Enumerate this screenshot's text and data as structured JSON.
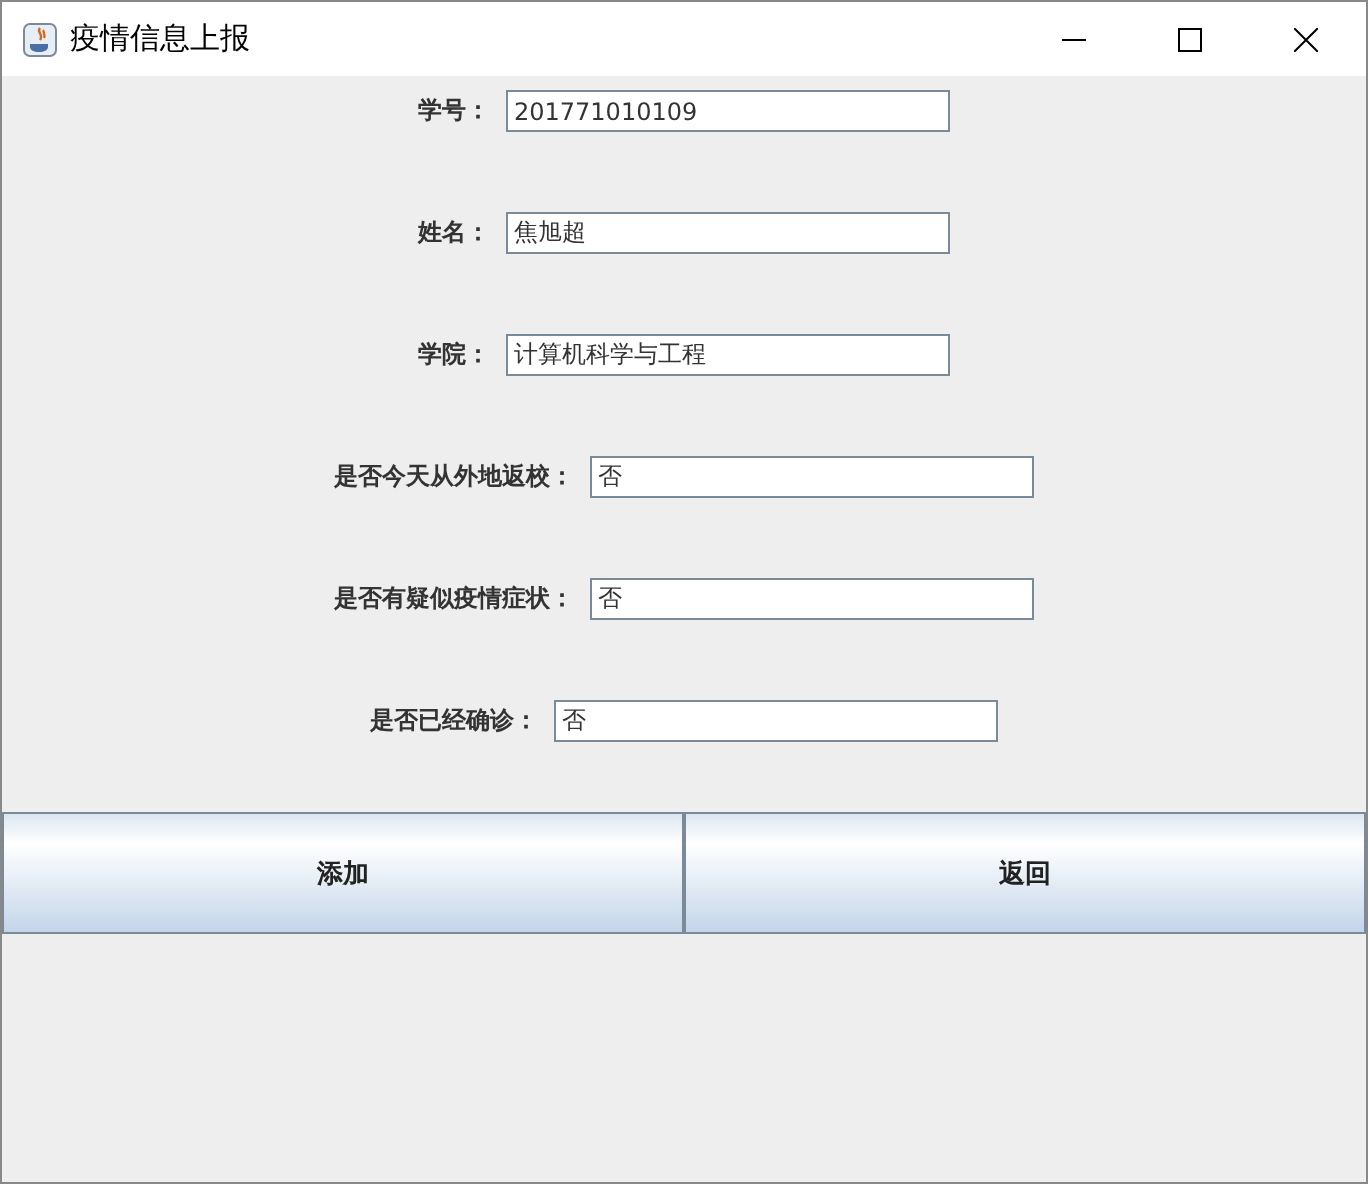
{
  "window": {
    "title": "疫情信息上报"
  },
  "fields": [
    {
      "label": "学号：",
      "value": "201771010109"
    },
    {
      "label": "姓名：",
      "value": "焦旭超"
    },
    {
      "label": "学院：",
      "value": "计算机科学与工程"
    },
    {
      "label": "是否今天从外地返校：",
      "value": "否"
    },
    {
      "label": "是否有疑似疫情症状：",
      "value": "否"
    },
    {
      "label": "是否已经确诊：",
      "value": "否"
    }
  ],
  "buttons": [
    "添加",
    "返回"
  ]
}
